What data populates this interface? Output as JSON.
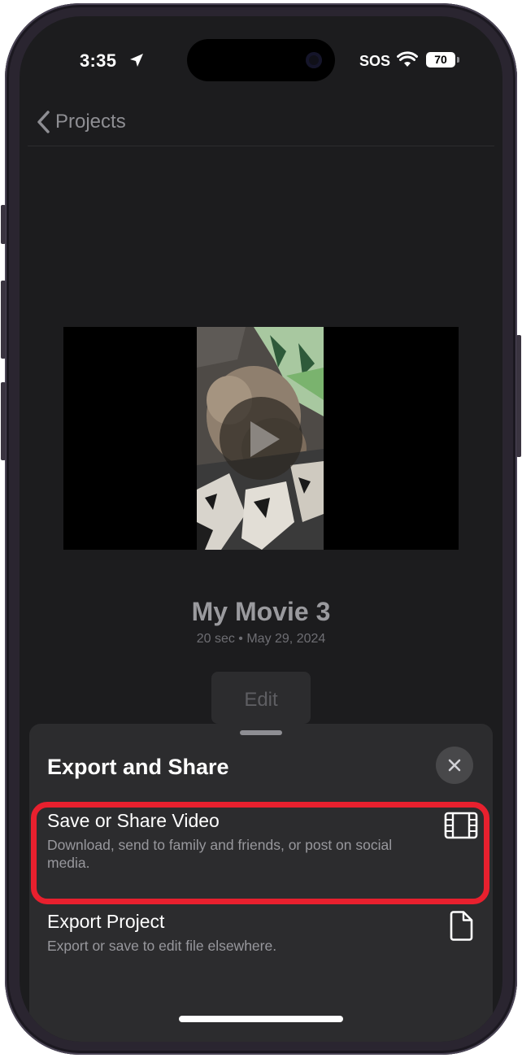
{
  "status_bar": {
    "time": "3:35",
    "sos": "SOS",
    "battery": "70",
    "icons": [
      "location-arrow-icon",
      "wifi-icon",
      "battery-icon"
    ]
  },
  "nav": {
    "back_label": "Projects",
    "back_icon": "chevron-left-icon"
  },
  "project": {
    "title": "My Movie 3",
    "meta": "20 sec • May 29, 2024",
    "edit_label": "Edit",
    "play_icon": "play-icon"
  },
  "sheet": {
    "title": "Export and Share",
    "close_icon": "close-icon",
    "options": [
      {
        "title": "Save or Share Video",
        "subtitle": "Download, send to family and friends, or post on social media.",
        "icon": "film-strip-icon",
        "highlighted": true
      },
      {
        "title": "Export Project",
        "subtitle": "Export or save to edit file elsewhere.",
        "icon": "document-icon"
      }
    ]
  },
  "colors": {
    "background": "#1c1c1e",
    "sheet": "#2c2c2e",
    "highlight": "#e8202e",
    "secondary_text": "#98989d"
  }
}
